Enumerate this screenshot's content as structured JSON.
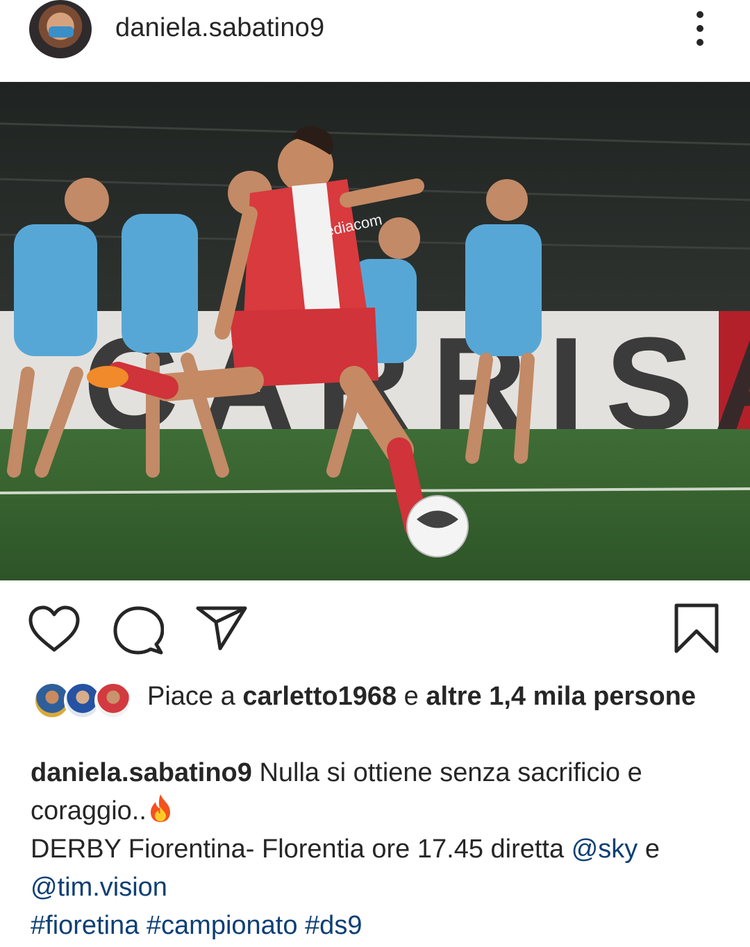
{
  "header": {
    "username": "daniela.sabatino9",
    "avatar_icon": "profile-avatar",
    "more_icon": "more-vertical-icon"
  },
  "post_image": {
    "description_icon": "post-photo",
    "jersey_sponsor": "Mediacom",
    "board_text": "CARRISA"
  },
  "actions": {
    "like_icon": "heart-icon",
    "comment_icon": "comment-icon",
    "share_icon": "send-icon",
    "save_icon": "bookmark-icon"
  },
  "likes": {
    "prefix": "Piace a ",
    "first_user": "carletto1968",
    "connector": " e ",
    "others": "altre 1,4 mila persone"
  },
  "caption": {
    "username": "daniela.sabatino9",
    "text_line1": " Nulla si ottiene senza sacrificio e coraggio..",
    "emoji": "fire-emoji",
    "text_line2": "DERBY Fiorentina- Florentia ore 17.45 diretta ",
    "mention1": "@sky",
    "text_between": " e ",
    "mention2": "@tim.vision",
    "hashtag1": "#fioretina",
    "hashtag2": "#campionato",
    "hashtag3": "#ds9"
  },
  "colors": {
    "text": "#262626",
    "link": "#0d3f75",
    "background": "#ffffff"
  }
}
